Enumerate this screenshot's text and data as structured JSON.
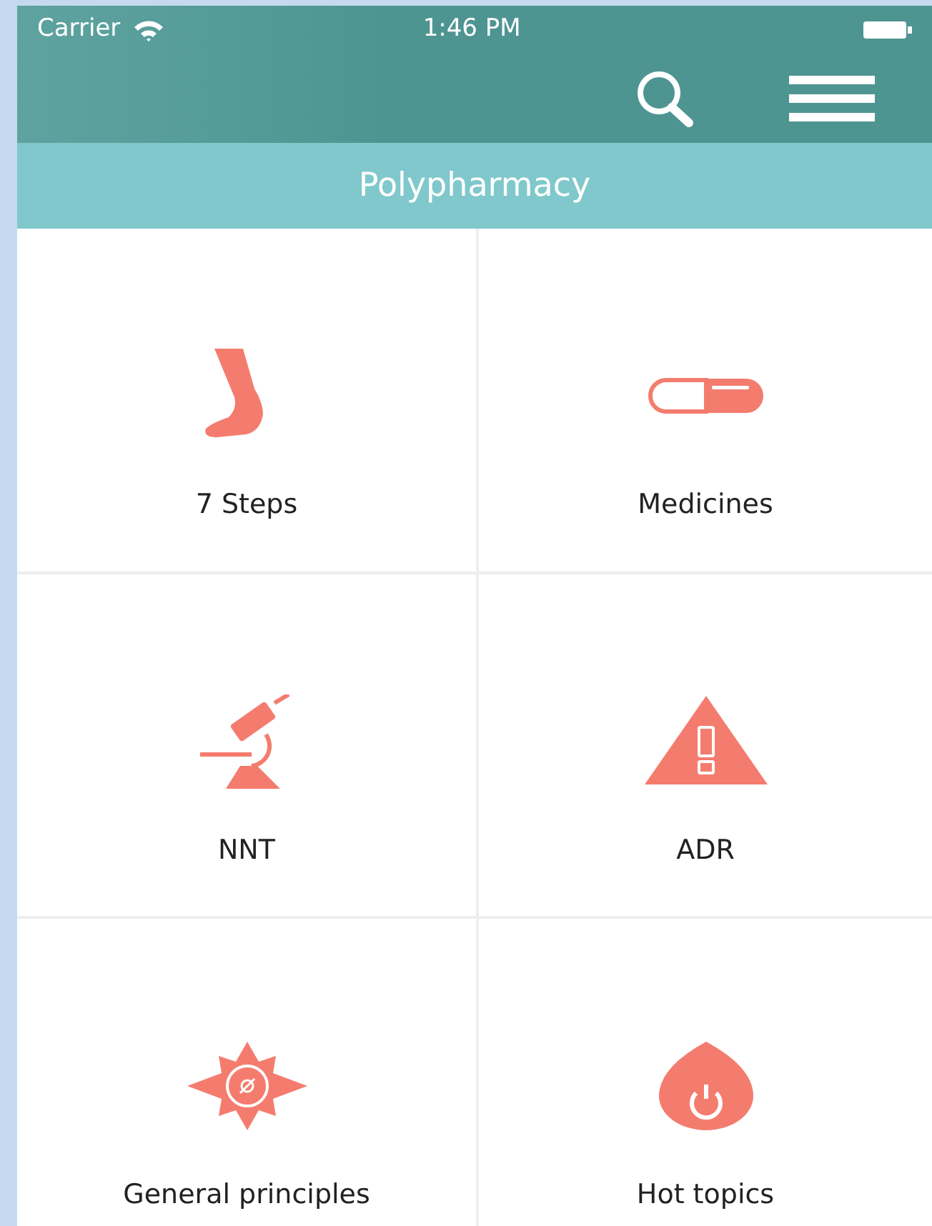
{
  "status_bar": {
    "carrier": "Carrier",
    "time": "1:46 PM"
  },
  "header": {
    "title": "Polypharmacy"
  },
  "tiles": [
    {
      "label": "7 Steps",
      "kind": "foot"
    },
    {
      "label": "Medicines",
      "kind": "pill"
    },
    {
      "label": "NNT",
      "kind": "microscope"
    },
    {
      "label": "ADR",
      "kind": "warning"
    },
    {
      "label": "General principles",
      "kind": "compass"
    },
    {
      "label": "Hot topics",
      "kind": "flame"
    }
  ]
}
